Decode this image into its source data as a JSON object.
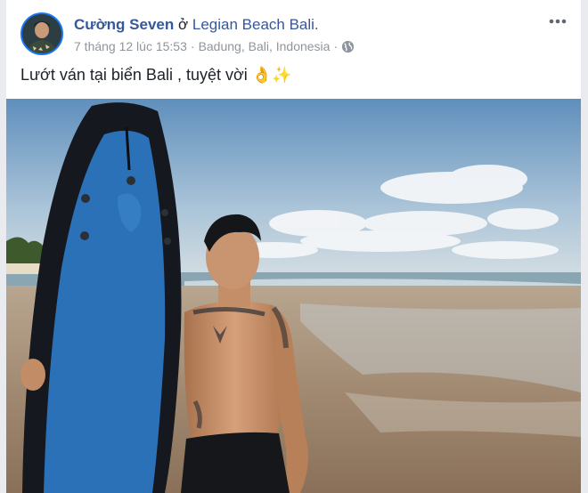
{
  "post": {
    "author": "Cường Seven",
    "location_prefix": "ở",
    "location": "Legian Beach Bali.",
    "timestamp": "7 tháng 12 lúc 15:53",
    "separator": "·",
    "place": "Badung, Bali, Indonesia",
    "privacy_icon": "globe-icon",
    "text": "Lướt ván tại biển Bali , tuyệt vời 👌✨"
  },
  "colors": {
    "link": "#365899",
    "meta": "#90949c",
    "avatar_ring": "#1877f2"
  }
}
